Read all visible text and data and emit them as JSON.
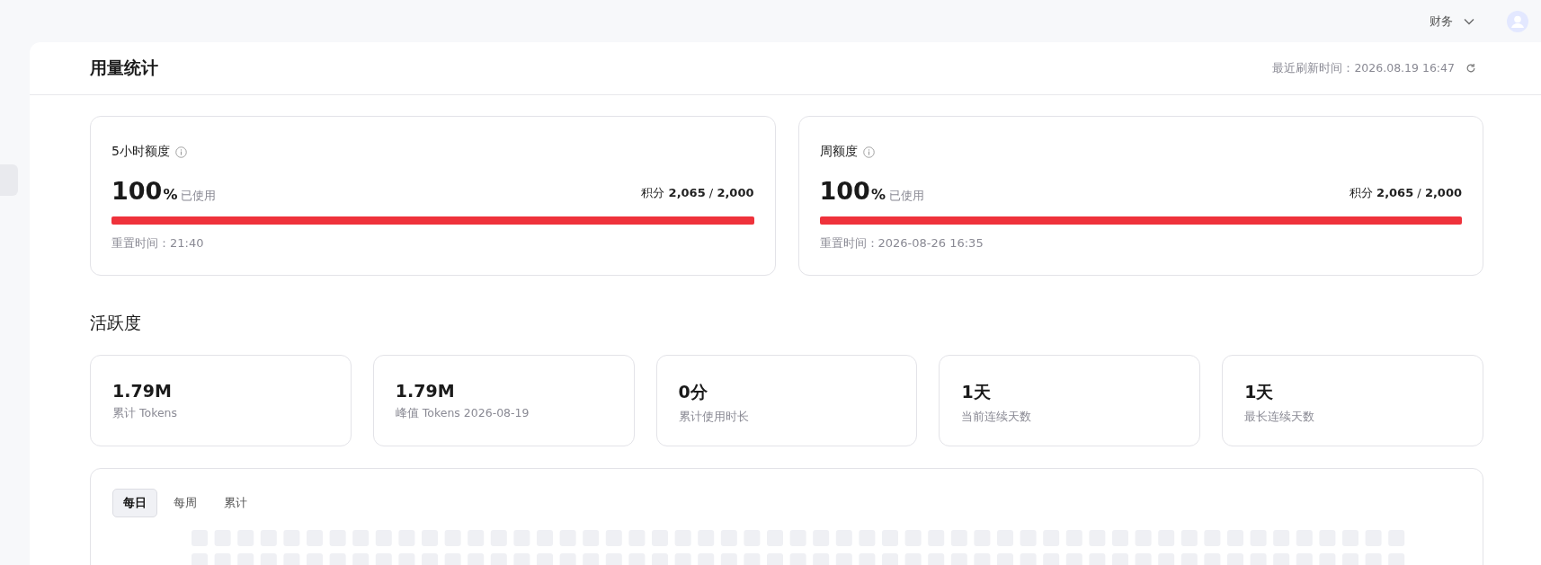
{
  "topbar": {
    "menu": "财务"
  },
  "page": {
    "title": "用量统计",
    "refresh": "最近刷新时间：2026.08.19 16:47"
  },
  "quotas": [
    {
      "title": "5小时额度",
      "percent": "100",
      "unit": "%",
      "used_label": "已使用",
      "points": "积分 **2,065** / **2,000**",
      "level": 1,
      "reset": "重置时间：21:40"
    },
    {
      "title": "周额度",
      "percent": "100",
      "unit": "%",
      "used_label": "已使用",
      "points": "积分 **2,065** / **2,000**",
      "level": 1,
      "reset": "重置时间：2026-08-26 16:35"
    }
  ],
  "activity": {
    "title": "活跃度",
    "stats": [
      {
        "value": "1.79M",
        "label": "累计 Tokens"
      },
      {
        "value": "1.79M",
        "label": "峰值 Tokens 2026-08-19"
      },
      {
        "value": "0分",
        "label": "累计使用时长"
      },
      {
        "value": "1天",
        "label": "当前连续天数"
      },
      {
        "value": "1天",
        "label": "最长连续天数"
      }
    ],
    "tabs": [
      {
        "label": "每日",
        "selected": true
      },
      {
        "label": "每周",
        "selected": false
      },
      {
        "label": "累计",
        "selected": false
      }
    ]
  }
}
